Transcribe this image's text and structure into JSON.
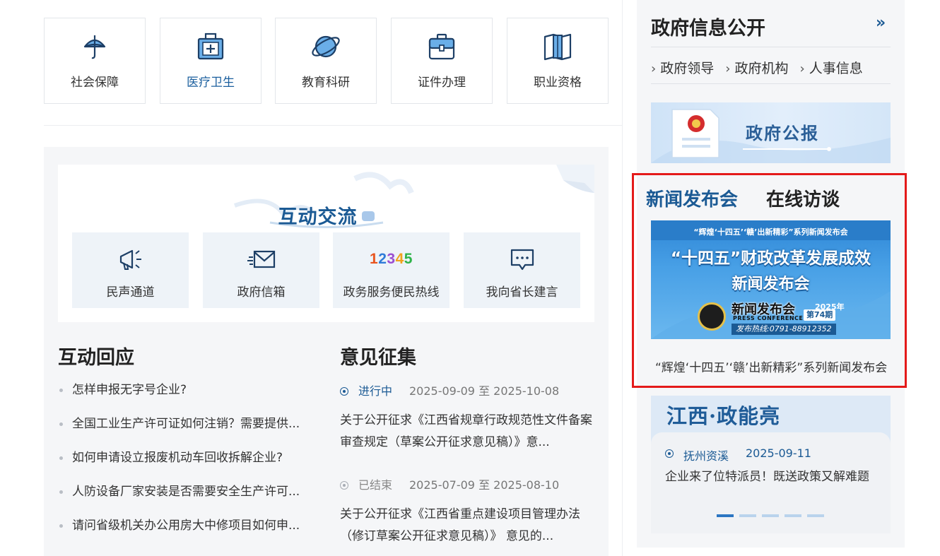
{
  "services": [
    {
      "label": "社会保障",
      "icon": "umbrella-icon"
    },
    {
      "label": "医疗卫生",
      "icon": "medical-kit-icon",
      "active": true
    },
    {
      "label": "教育科研",
      "icon": "planet-icon"
    },
    {
      "label": "证件办理",
      "icon": "briefcase-icon"
    },
    {
      "label": "职业资格",
      "icon": "book-icon"
    }
  ],
  "interaction": {
    "title": "互动交流",
    "tiles": [
      {
        "label": "民声通道",
        "icon": "megaphone-icon"
      },
      {
        "label": "政府信箱",
        "icon": "mail-icon"
      },
      {
        "label": "政务服务便民热线",
        "icon": "hotline-12345-icon",
        "number": [
          "1",
          "2",
          "3",
          "4",
          "5"
        ]
      },
      {
        "label": "我向省长建言",
        "icon": "chat-bubble-icon"
      }
    ]
  },
  "responses": {
    "title": "互动回应",
    "items": [
      "怎样申报无字号企业?",
      "全国工业生产许可证如何注销？需要提供...",
      "如何申请设立报废机动车回收拆解企业?",
      "人防设备厂家安装是否需要安全生产许可...",
      "请问省级机关办公用房大中修项目如何申..."
    ]
  },
  "opinions": {
    "title": "意见征集",
    "items": [
      {
        "status": "进行中",
        "dates": "2025-09-09 至 2025-10-08",
        "text": "关于公开征求《江西省规章行政规范性文件备案审查规定（草案公开征求意见稿）》意..."
      },
      {
        "status": "已结束",
        "dates": "2025-07-09 至 2025-08-10",
        "text": "关于公开征求《江西省重点建设项目管理办法（修订草案公开征求意见稿）》 意见的..."
      }
    ]
  },
  "gov_info": {
    "title": "政府信息公开",
    "more_icon": "double-chevron-right-icon",
    "links": [
      "政府领导",
      "政府机构",
      "人事信息"
    ],
    "gazette": "政府公报"
  },
  "news": {
    "tabs": [
      "新闻发布会",
      "在线访谈"
    ],
    "banner": {
      "series": "“辉煌‘十四五’‘赣’出新精彩”系列新闻发布会",
      "title_line1": "“十四五”财政改革发展成效",
      "title_line2": "新闻发布会",
      "brand": "新闻发布会",
      "brand_en": "PRESS CONFERENCE",
      "year": "2025年",
      "issue": "第74期",
      "hotline": "发布热线:0791-88912352"
    },
    "caption": "“辉煌‘十四五’‘赣’出新精彩”系列新闻发布会"
  },
  "jiangxi": {
    "title": "江西·政能亮",
    "location": "抚州资溪",
    "date": "2025-09-11",
    "text": "企业来了位特派员！既送政策又解难题",
    "slides": 5,
    "active_slide": 0
  },
  "colors": {
    "accent": "#1b5a94",
    "highlight_border": "#e41a1a",
    "panel_bg": "#f5f6f8",
    "num_colors": [
      "#e8541e",
      "#2f7cd8",
      "#9b4fd1",
      "#f0a21c",
      "#2fb34a"
    ]
  }
}
